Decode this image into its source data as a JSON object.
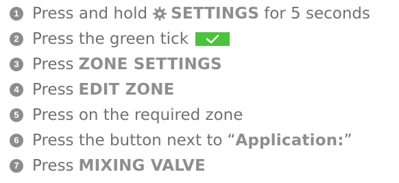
{
  "steps": [
    {
      "num": "1",
      "press": "Press and hold",
      "keyword": "SETTINGS",
      "rest": "for 5 seconds",
      "icon": "gear-icon"
    },
    {
      "num": "2",
      "text": "Press the green tick",
      "icon": "checkmark-icon",
      "tick_color": "#4cc23d"
    },
    {
      "num": "3",
      "press": "Press",
      "keyword": "ZONE SETTINGS"
    },
    {
      "num": "4",
      "press": "Press",
      "keyword": "EDIT ZONE"
    },
    {
      "num": "5",
      "text": "Press on the required zone"
    },
    {
      "num": "6",
      "press": "Press the button next to",
      "open_quote": "“",
      "keyword": "Application:",
      "close_quote": "”"
    },
    {
      "num": "7",
      "press": "Press",
      "keyword": "MIXING VALVE"
    }
  ]
}
